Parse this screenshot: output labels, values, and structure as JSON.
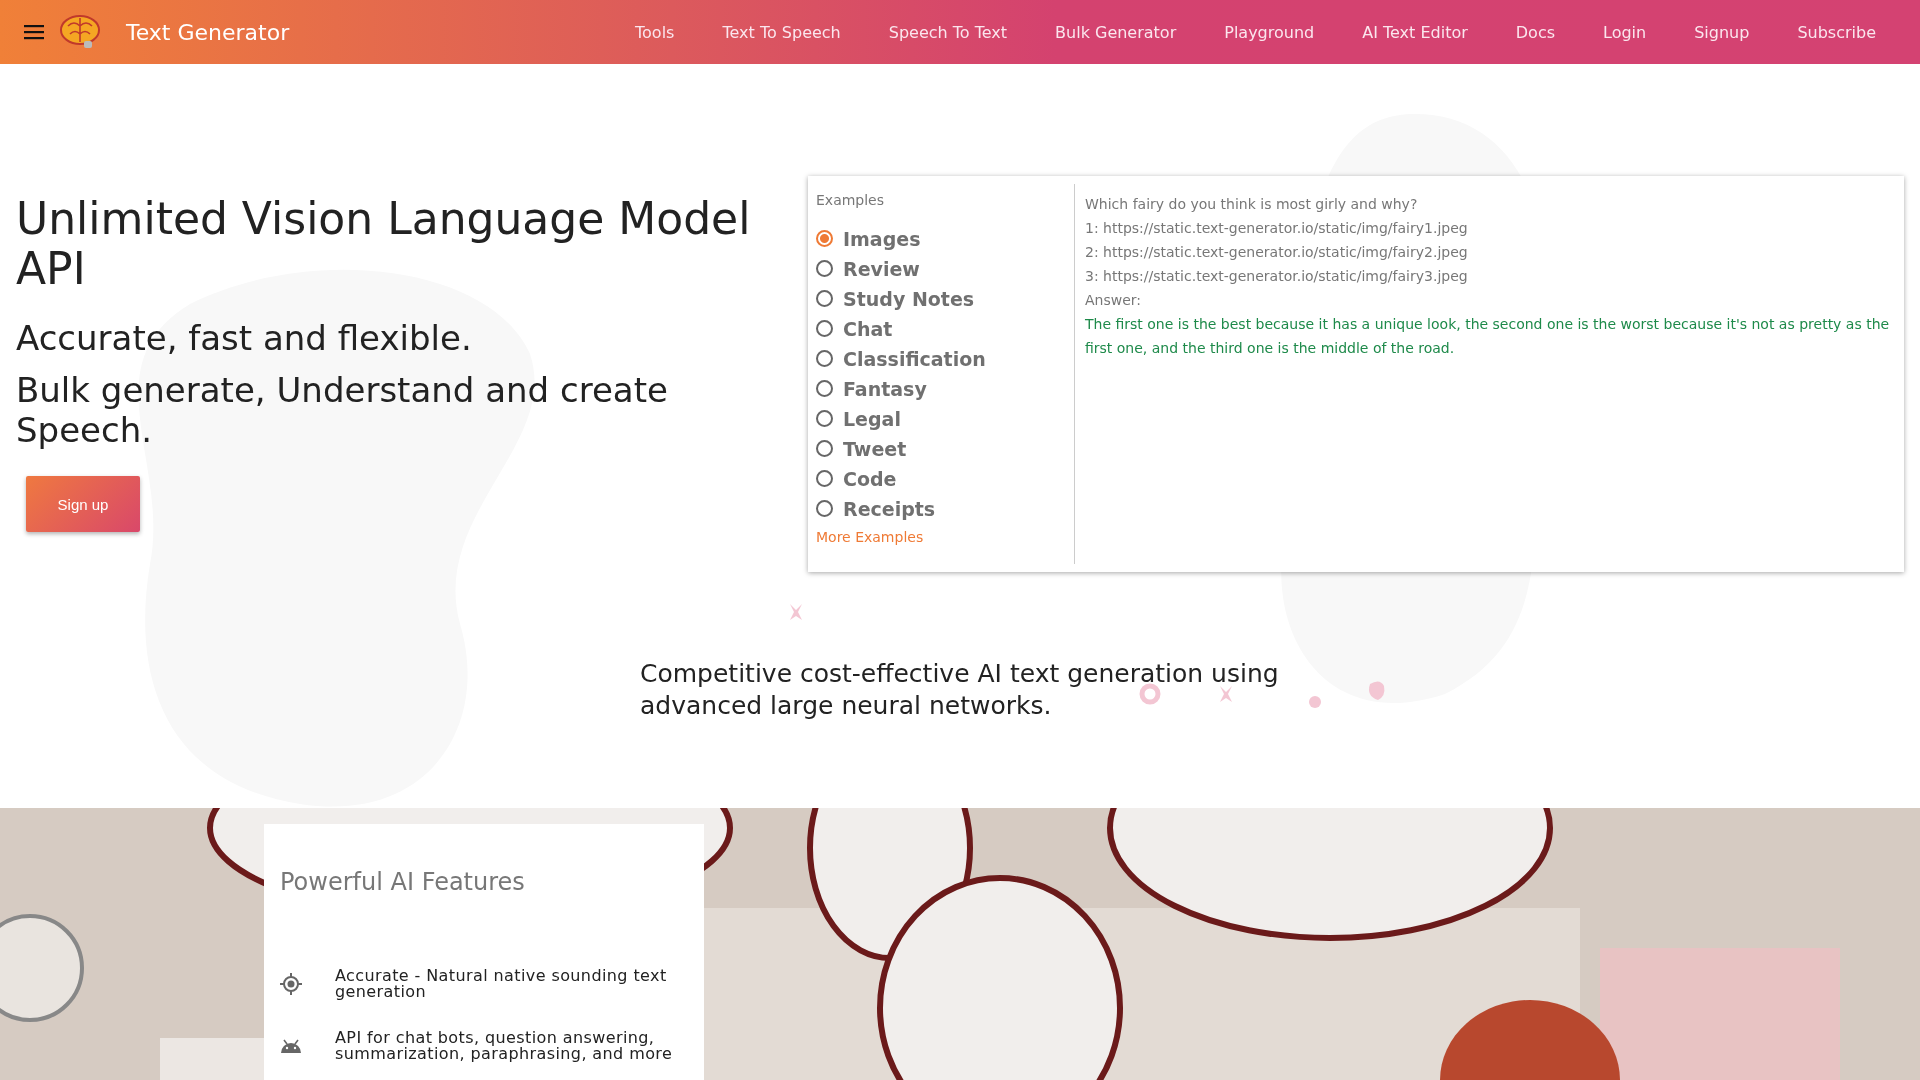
{
  "header": {
    "brand": "Text Generator",
    "nav": [
      "Tools",
      "Text To Speech",
      "Speech To Text",
      "Bulk Generator",
      "Playground",
      "AI Text Editor",
      "Docs",
      "Login",
      "Signup",
      "Subscribe"
    ]
  },
  "hero": {
    "title": "Unlimited Vision Language Model API",
    "subtitle": "Accurate, fast and flexible.",
    "subtitle_2": "Bulk generate, Understand and create Speech.",
    "signup_button": "Sign up"
  },
  "examples": {
    "heading": "Examples",
    "items": [
      {
        "label": "Images",
        "selected": true
      },
      {
        "label": "Review",
        "selected": false
      },
      {
        "label": "Study Notes",
        "selected": false
      },
      {
        "label": "Chat",
        "selected": false
      },
      {
        "label": "Classification",
        "selected": false
      },
      {
        "label": "Fantasy",
        "selected": false
      },
      {
        "label": "Legal",
        "selected": false
      },
      {
        "label": "Tweet",
        "selected": false
      },
      {
        "label": "Code",
        "selected": false
      },
      {
        "label": "Receipts",
        "selected": false
      }
    ],
    "more_link": "More Examples",
    "prompt_lines": [
      "Which fairy do you think is most girly and why?",
      "1: https://static.text-generator.io/static/img/fairy1.jpeg",
      "2: https://static.text-generator.io/static/img/fairy2.jpeg",
      "3: https://static.text-generator.io/static/img/fairy3.jpeg",
      "Answer:"
    ],
    "answer": "The first one is the best because it has a unique look, the second one is the worst because it's not as pretty as the first one, and the third one is the middle of the road."
  },
  "tagline": "Competitive cost-effective AI text generation using advanced large neural networks.",
  "features": {
    "title": "Powerful AI Features",
    "items": [
      {
        "kind": "target",
        "text": "Accurate - Natural native sounding text generation"
      },
      {
        "kind": "android",
        "text": "API for chat bots, question answering, summarization, paraphrasing, and more"
      }
    ]
  }
}
